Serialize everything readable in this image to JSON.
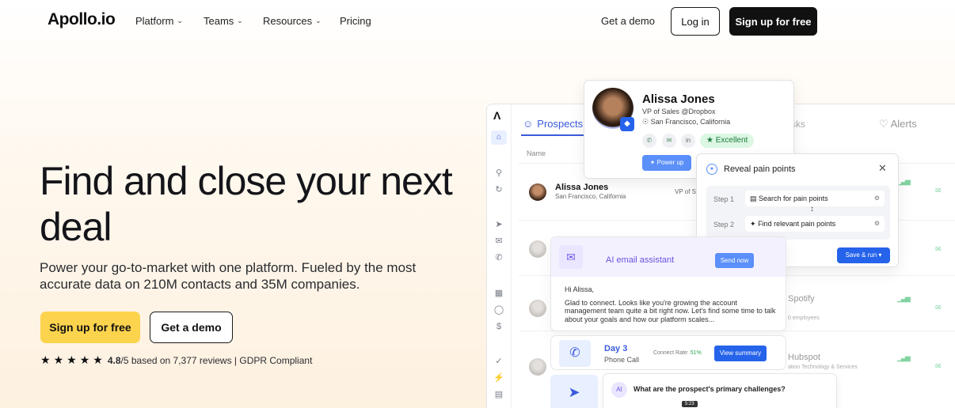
{
  "nav": {
    "logo": "Apollo.io",
    "items": [
      "Platform",
      "Teams",
      "Resources"
    ],
    "pricing": "Pricing",
    "get_demo": "Get a demo",
    "login": "Log in",
    "signup": "Sign up for free"
  },
  "hero": {
    "title": "Find and close your next deal",
    "subtitle": "Power your go-to-market with one platform. Fueled by the most accurate data on 210M contacts and 35M companies.",
    "signup": "Sign up for free",
    "demo": "Get a demo",
    "rating_score": "4.8",
    "rating_rest": "/5 based on 7,377 reviews | GDPR Compliant",
    "stars": 5
  },
  "app": {
    "tab_prospects": "Prospects",
    "tab_tasks": "sks",
    "tab_alerts": "Alerts",
    "col_name": "Name",
    "row": {
      "name": "Alissa Jones",
      "location": "San Francisco, California",
      "title": "VP of S"
    },
    "companies": [
      {
        "name": "Spotify",
        "sub": "0 employees"
      },
      {
        "name": "Hubspot",
        "sub": "ation Technology & Services"
      }
    ]
  },
  "profile": {
    "name": "Alissa Jones",
    "title": "VP of Sales @Dropbox",
    "location": "San Francisco, California",
    "badge": "Excellent",
    "powerup": "Power up"
  },
  "reveal": {
    "title": "Reveal pain points",
    "step1_label": "Step 1",
    "step1": "Search for pain points",
    "step2_label": "Step 2",
    "step2": "Find relevant pain points",
    "save": "Save & run"
  },
  "ai_email": {
    "title": "AI email assistant",
    "send": "Send now",
    "greeting": "Hi Alissa,",
    "body": "Glad to connect. Looks like you're growing the account management team quite a bit right now. Let's find some time to talk about your goals and how our platform scales..."
  },
  "call": {
    "title": "Day 3",
    "sub": "Phone Call",
    "connect_label": "Connect Rate: ",
    "connect_value": "51%",
    "view": "View summary"
  },
  "question": {
    "text": "What are the prospect's primary challenges?",
    "time": "5:23"
  },
  "colors": {
    "accent": "#3b5bdb",
    "cta": "#fcd34d",
    "ai": "#6a52e0"
  }
}
